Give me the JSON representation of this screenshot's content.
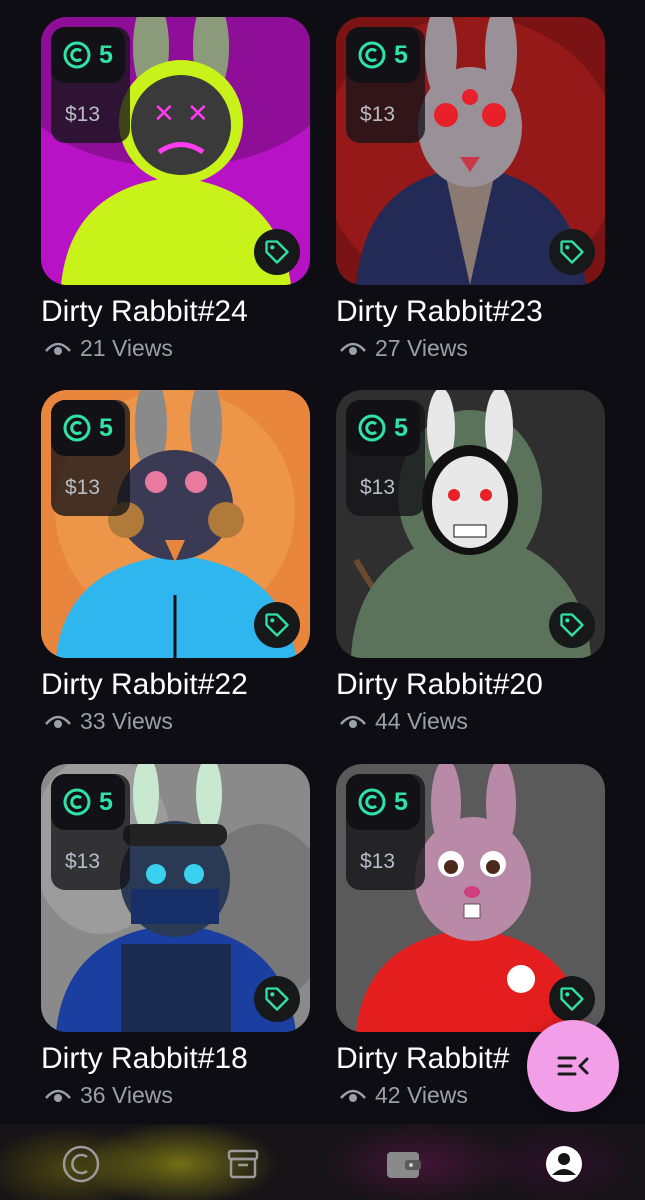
{
  "cards": [
    {
      "title": "Dirty Rabbit#24",
      "views": "21 Views",
      "coin": "5",
      "price": "$13",
      "bg": "#b812c7",
      "hoodie": "#c8f21a",
      "face": "#3a3a3a"
    },
    {
      "title": "Dirty Rabbit#23",
      "views": "27 Views",
      "coin": "5",
      "price": "$13",
      "bg": "#7a1414",
      "hoodie": "#222a55",
      "face": "#9a9097"
    },
    {
      "title": "Dirty Rabbit#22",
      "views": "33 Views",
      "coin": "5",
      "price": "$13",
      "bg": "#e8863e",
      "hoodie": "#2fb6ef",
      "face": "#3a3a55"
    },
    {
      "title": "Dirty Rabbit#20",
      "views": "44 Views",
      "coin": "5",
      "price": "$13",
      "bg": "#2e2f2e",
      "hoodie": "#5b735a",
      "face": "#e8e8e8"
    },
    {
      "title": "Dirty Rabbit#18",
      "views": "36 Views",
      "coin": "5",
      "price": "$13",
      "bg": "#8a8a8a",
      "hoodie": "#1a3fa0",
      "face": "#2a3a55"
    },
    {
      "title": "Dirty Rabbit#",
      "views": "42 Views",
      "coin": "5",
      "price": "$13",
      "bg": "#5a5a5a",
      "hoodie": "#e41e1e",
      "face": "#b88aa7"
    }
  ],
  "accent": "#2fe2a6",
  "fab_color": "#f29ee8",
  "nav": [
    {
      "name": "coin-tab-icon"
    },
    {
      "name": "archive-tab-icon"
    },
    {
      "name": "wallet-tab-icon"
    },
    {
      "name": "profile-tab-icon",
      "active": true
    }
  ]
}
